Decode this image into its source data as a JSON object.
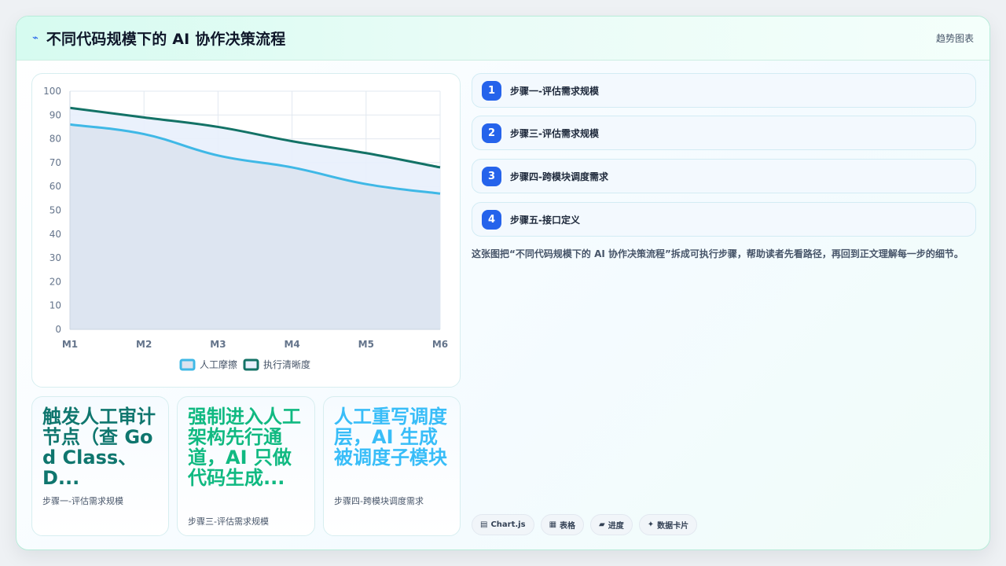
{
  "header": {
    "icon": "lightning-icon",
    "title": "不同代码规模下的 AI 协作决策流程",
    "right_label": "趋势图表"
  },
  "chart_data": {
    "type": "line",
    "categories": [
      "M1",
      "M2",
      "M3",
      "M4",
      "M5",
      "M6"
    ],
    "y_ticks": [
      "0",
      "10",
      "20",
      "30",
      "40",
      "50",
      "60",
      "70",
      "80",
      "90",
      "100"
    ],
    "ylim": [
      0,
      100
    ],
    "grid": true,
    "legend_position": "bottom",
    "series": [
      {
        "name": "人工摩擦",
        "values": [
          86,
          82,
          73,
          68,
          61,
          57
        ],
        "color": "#3fb8e6",
        "fill": "#dbe3ef"
      },
      {
        "name": "执行清晰度",
        "values": [
          93,
          89,
          85,
          79,
          74,
          68
        ],
        "color": "#137266",
        "fill": "#e8f0fc"
      }
    ]
  },
  "stat_cards": [
    {
      "value": "触发人工审计节点（查 God Class、D...",
      "label": "步骤一-评估需求规模",
      "color": "#0f766e"
    },
    {
      "value": "强制进入人工架构先行通道，AI 只做代码生成...",
      "label": "步骤三-评估需求规模",
      "color": "#10b981"
    },
    {
      "value": "人工重写调度层，AI 生成被调度子模块",
      "label": "步骤四-跨模块调度需求",
      "color": "#38bdf8"
    }
  ],
  "steps": [
    {
      "num": "1",
      "text": "步骤一-评估需求规模"
    },
    {
      "num": "2",
      "text": "步骤三-评估需求规模"
    },
    {
      "num": "3",
      "text": "步骤四-跨模块调度需求"
    },
    {
      "num": "4",
      "text": "步骤五-接口定义"
    }
  ],
  "description": "这张图把“不同代码规模下的 AI 协作决策流程”拆成可执行步骤，帮助读者先看路径，再回到正文理解每一步的细节。",
  "tags": [
    {
      "icon": "▤",
      "label": "Chart.js"
    },
    {
      "icon": "▦",
      "label": "表格"
    },
    {
      "icon": "▰",
      "label": "进度"
    },
    {
      "icon": "✦",
      "label": "数据卡片"
    }
  ]
}
